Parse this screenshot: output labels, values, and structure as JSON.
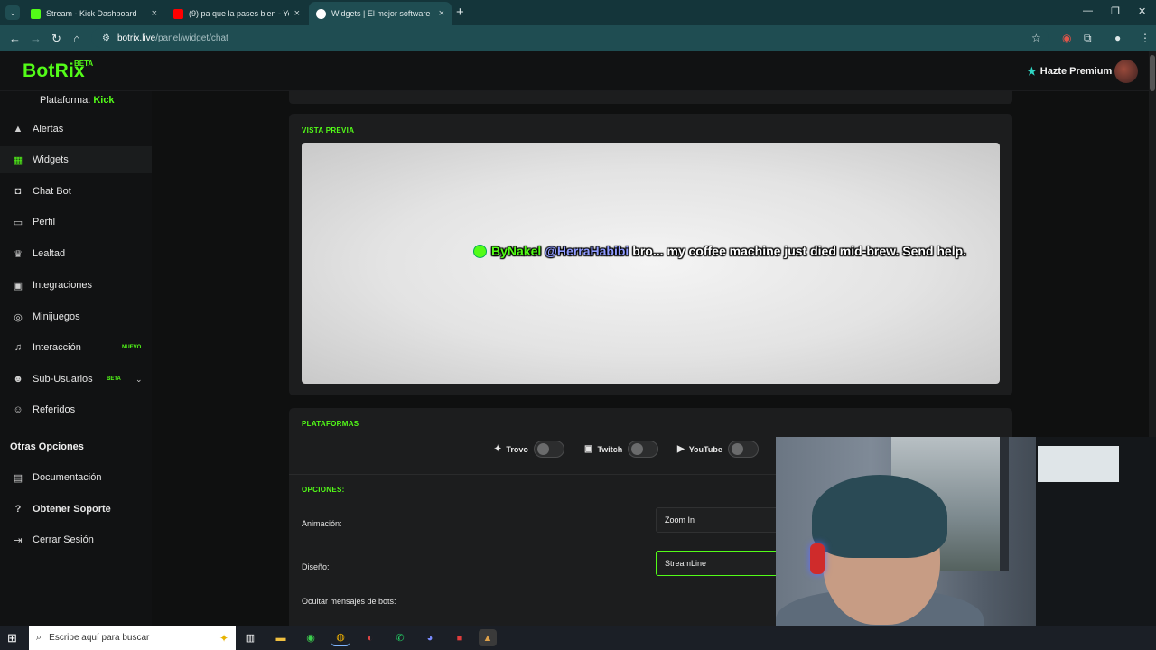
{
  "browser": {
    "tabs": [
      {
        "title": "Stream - Kick Dashboard",
        "color": "#53fc18"
      },
      {
        "title": "(9) pa que la pases bien - YouTu",
        "color": "#ff0000"
      },
      {
        "title": "Widgets | El mejor software pa",
        "color": "#ffffff"
      }
    ],
    "url_host": "botrix.live",
    "url_path": "/panel/widget/chat"
  },
  "header": {
    "logo": "BotRix",
    "logo_badge": "BETA",
    "premium_label": "Hazte Premium"
  },
  "sidebar": {
    "platform_label": "Plataforma:",
    "platform_value": "Kick",
    "items": [
      {
        "label": "Alertas",
        "icon": "warning-icon"
      },
      {
        "label": "Widgets",
        "icon": "widgets-icon"
      },
      {
        "label": "Chat Bot",
        "icon": "robot-icon"
      },
      {
        "label": "Perfil",
        "icon": "id-card-icon"
      },
      {
        "label": "Lealtad",
        "icon": "trophy-icon"
      },
      {
        "label": "Integraciones",
        "icon": "integrations-icon"
      },
      {
        "label": "Minijuegos",
        "icon": "gamepad-icon"
      },
      {
        "label": "Interacción",
        "icon": "music-icon"
      },
      {
        "label": "Sub-Usuarios",
        "icon": "users-icon"
      },
      {
        "label": "Referidos",
        "icon": "referrals-icon"
      }
    ],
    "badge_new": "NUEVO",
    "badge_beta": "BETA",
    "section_other": "Otras Opciones",
    "other_items": [
      {
        "label": "Documentación",
        "icon": "document-icon"
      },
      {
        "label": "Obtener Soporte",
        "icon": "help-icon"
      },
      {
        "label": "Cerrar Sesión",
        "icon": "logout-icon"
      }
    ]
  },
  "preview": {
    "label": "VISTA PREVIA",
    "username": "ByNakel",
    "mention": "@HerraHabibi",
    "message": "bro... my coffee machine just died mid-brew. Send help."
  },
  "platforms": {
    "label": "PLATAFORMAS",
    "items": [
      {
        "name": "Trovo",
        "enabled": false
      },
      {
        "name": "Twitch",
        "enabled": false
      },
      {
        "name": "YouTube",
        "enabled": false
      }
    ]
  },
  "options": {
    "label": "OPCIONES:",
    "animation_label": "Animación:",
    "animation_value": "Zoom In",
    "design_label": "Diseño:",
    "design_value": "StreamLine",
    "hide_bots_label": "Ocultar mensajes de bots:"
  },
  "taskbar": {
    "search_placeholder": "Escribe aquí para buscar"
  }
}
